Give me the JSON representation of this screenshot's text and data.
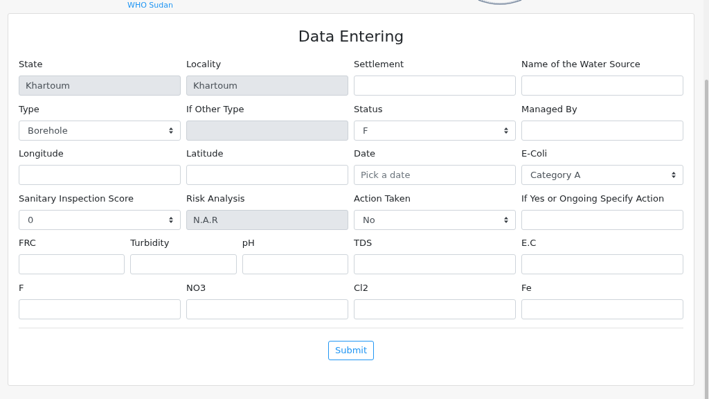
{
  "header": {
    "link": "WHO Sudan"
  },
  "form": {
    "title": "Data Entering",
    "rows": [
      {
        "fields": [
          {
            "kind": "text",
            "label": "State",
            "value": "Khartoum",
            "disabled": true
          },
          {
            "kind": "text",
            "label": "Locality",
            "value": "Khartoum",
            "disabled": true
          },
          {
            "kind": "text",
            "label": "Settlement",
            "disabled": false
          },
          {
            "kind": "text",
            "label": "Name of the Water Source",
            "disabled": false
          }
        ]
      },
      {
        "fields": [
          {
            "kind": "select",
            "label": "Type",
            "value": "Borehole",
            "disabled": false
          },
          {
            "kind": "text",
            "label": "If Other Type",
            "disabled": true
          },
          {
            "kind": "select",
            "label": "Status",
            "value": "F",
            "disabled": false
          },
          {
            "kind": "text",
            "label": "Managed By",
            "disabled": false
          }
        ]
      },
      {
        "fields": [
          {
            "kind": "text",
            "label": "Longitude",
            "disabled": false
          },
          {
            "kind": "text",
            "label": "Latitude",
            "disabled": false
          },
          {
            "kind": "date",
            "label": "Date",
            "placeholder": "Pick a date",
            "disabled": false
          },
          {
            "kind": "select",
            "label": "E-Coli",
            "value": "Category A",
            "disabled": false
          }
        ]
      },
      {
        "fields": [
          {
            "kind": "select",
            "label": "Sanitary Inspection Score",
            "value": "0",
            "disabled": false
          },
          {
            "kind": "text",
            "label": "Risk Analysis",
            "value": "N.A.R",
            "disabled": true
          },
          {
            "kind": "select",
            "label": "Action Taken",
            "value": "No",
            "disabled": false
          },
          {
            "kind": "text",
            "label": "If Yes or Ongoing Specify Action",
            "disabled": false
          }
        ]
      },
      {
        "fields": [
          {
            "kind": "group",
            "fields": [
              {
                "kind": "text",
                "label": "FRC",
                "disabled": false
              },
              {
                "kind": "text",
                "label": "Turbidity",
                "disabled": false
              },
              {
                "kind": "text",
                "label": "pH",
                "disabled": false
              }
            ]
          },
          {
            "kind": "text",
            "label": "TDS",
            "disabled": false
          },
          {
            "kind": "text",
            "label": "E.C",
            "disabled": false
          }
        ]
      },
      {
        "fields": [
          {
            "kind": "text",
            "label": "F",
            "disabled": false
          },
          {
            "kind": "text",
            "label": "NO3",
            "disabled": false
          },
          {
            "kind": "text",
            "label": "Cl2",
            "disabled": false
          },
          {
            "kind": "text",
            "label": "Fe",
            "disabled": false
          }
        ]
      }
    ],
    "submit": "Submit"
  }
}
